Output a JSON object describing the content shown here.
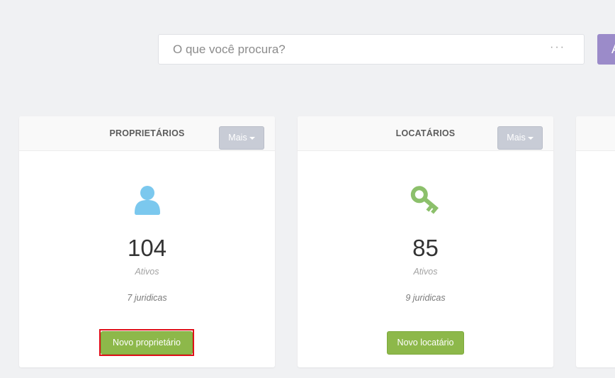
{
  "search": {
    "placeholder": "O que você procura?",
    "dots": "···",
    "action_label": "A"
  },
  "cards": [
    {
      "title": "PROPRIETÁRIOS",
      "more_label": "Mais",
      "icon": "user-icon",
      "icon_color": "#7bc8ee",
      "count": "104",
      "status": "Ativos",
      "sub": "7 juridicas",
      "action_label": "Novo proprietário"
    },
    {
      "title": "LOCATÁRIOS",
      "more_label": "Mais",
      "icon": "key-icon",
      "icon_color": "#8cc06b",
      "count": "85",
      "status": "Ativos",
      "sub": "9 juridicas",
      "action_label": "Novo locatário"
    }
  ],
  "colors": {
    "background": "#f0f1f3",
    "button_green": "#8db84a",
    "button_gray": "#c8ccd6",
    "accent_purple": "#9b8bc9",
    "highlight_red": "#e0101a"
  }
}
